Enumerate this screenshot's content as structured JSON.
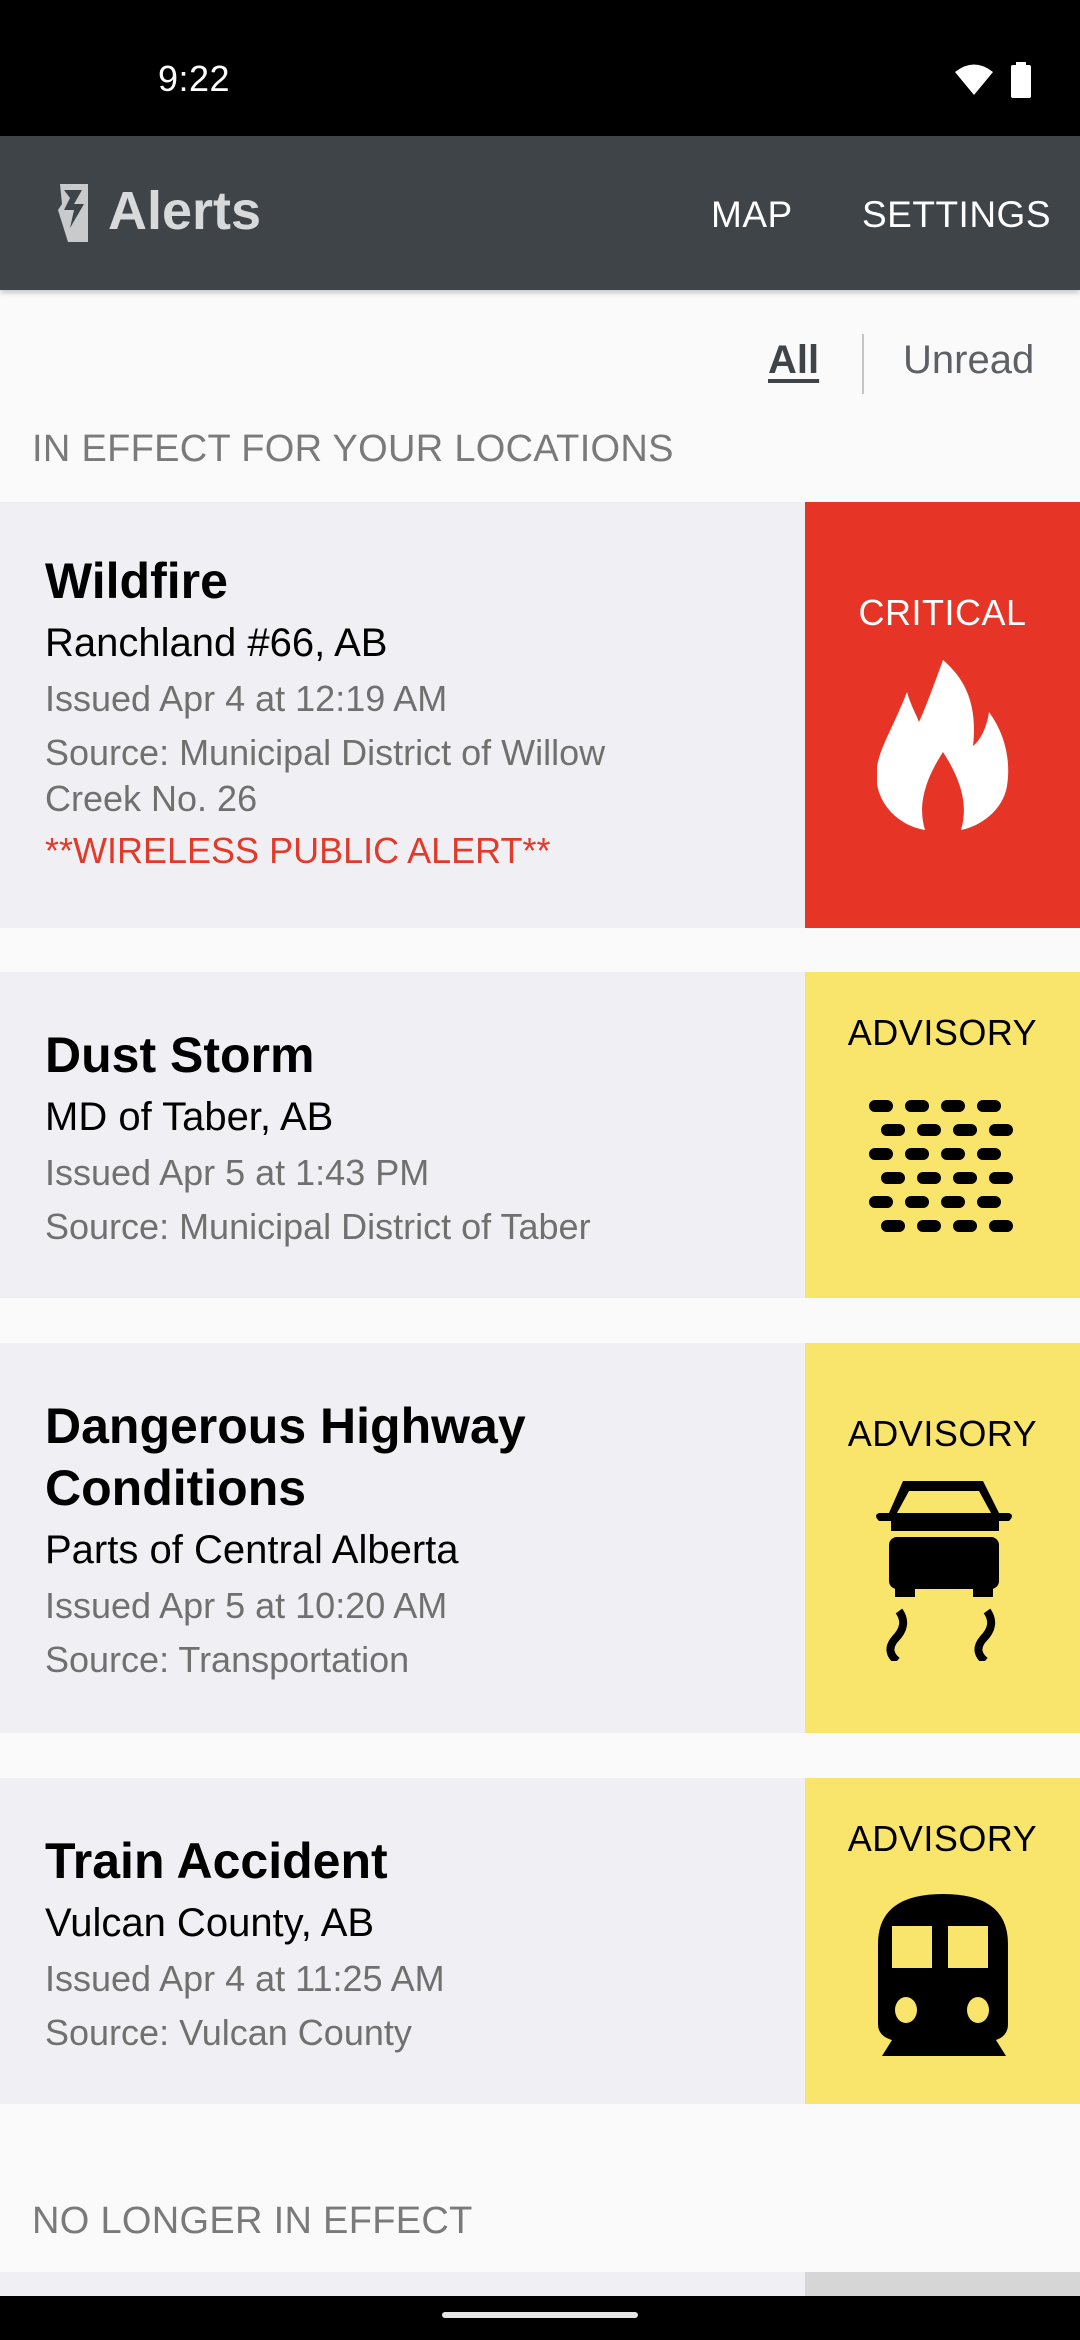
{
  "status_bar": {
    "time": "9:22",
    "icons": [
      "wifi-icon",
      "battery-icon"
    ]
  },
  "app_bar": {
    "logo_icon": "alberta-lightning-logo",
    "title": "Alerts",
    "actions": [
      {
        "label": "MAP"
      },
      {
        "label": "SETTINGS"
      }
    ]
  },
  "filters": {
    "all_label": "All",
    "unread_label": "Unread",
    "selected": "All"
  },
  "sections": {
    "active_title": "IN EFFECT FOR YOUR LOCATIONS",
    "expired_title": "NO LONGER IN EFFECT"
  },
  "alerts": [
    {
      "title": "Wildfire",
      "location": "Ranchland #66, AB",
      "issued": "Issued Apr 4 at 12:19 AM",
      "source": "Source: Municipal District of Willow Creek No. 26",
      "note": "**WIRELESS PUBLIC ALERT**",
      "level": "CRITICAL",
      "icon": "fire-icon",
      "color": "#e63526"
    },
    {
      "title": "Dust Storm",
      "location": "MD of Taber, AB",
      "issued": "Issued Apr 5 at 1:43 PM",
      "source": "Source: Municipal District of Taber",
      "level": "ADVISORY",
      "icon": "dust-storm-icon",
      "color": "#f9e46c"
    },
    {
      "title": "Dangerous Highway Conditions",
      "location": "Parts of Central Alberta",
      "issued": "Issued Apr 5 at 10:20 AM",
      "source": "Source: Transportation",
      "level": "ADVISORY",
      "icon": "slippery-road-car-icon",
      "color": "#f9e46c"
    },
    {
      "title": "Train Accident",
      "location": "Vulcan County, AB",
      "issued": "Issued Apr 4 at 11:25 AM",
      "source": "Source: Vulcan County",
      "level": "ADVISORY",
      "icon": "train-icon",
      "color": "#f9e46c"
    }
  ],
  "colors": {
    "app_bar": "#3f4448",
    "critical": "#e63526",
    "advisory": "#f9e46c",
    "card_bg": "#f0f0f4",
    "expired_badge": "#d6d6d6"
  }
}
